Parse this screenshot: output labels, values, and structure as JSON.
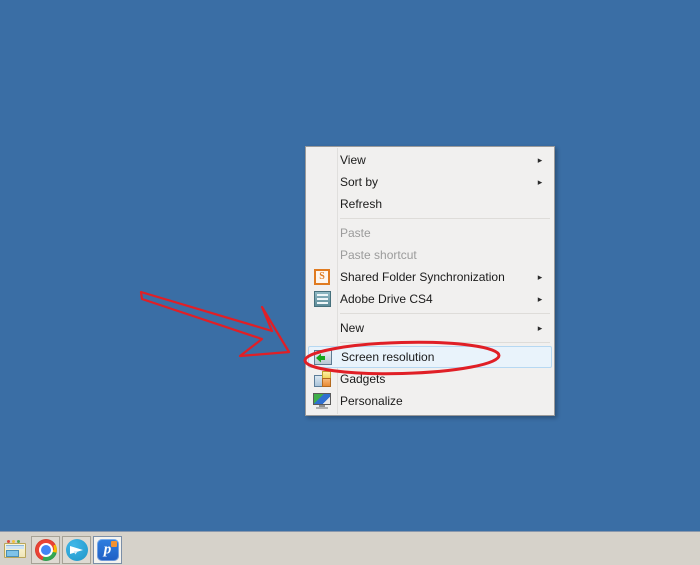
{
  "desktop": {
    "background_color": "#3a6ea5"
  },
  "context_menu": {
    "items": [
      {
        "label": "View",
        "icon": "none",
        "arrow": "▸",
        "disabled": false,
        "highlight": false
      },
      {
        "label": "Sort by",
        "icon": "none",
        "arrow": "▸",
        "disabled": false,
        "highlight": false
      },
      {
        "label": "Refresh",
        "icon": "none",
        "arrow": "",
        "disabled": false,
        "highlight": false
      },
      {
        "separator": true
      },
      {
        "label": "Paste",
        "icon": "none",
        "arrow": "",
        "disabled": true,
        "highlight": false
      },
      {
        "label": "Paste shortcut",
        "icon": "none",
        "arrow": "",
        "disabled": true,
        "highlight": false
      },
      {
        "label": "Shared Folder Synchronization",
        "icon": "shared-folder-sync-icon",
        "arrow": "▸",
        "disabled": false,
        "highlight": false
      },
      {
        "label": "Adobe Drive CS4",
        "icon": "adobe-drive-icon",
        "arrow": "▸",
        "disabled": false,
        "highlight": false
      },
      {
        "separator": true
      },
      {
        "label": "New",
        "icon": "none",
        "arrow": "▸",
        "disabled": false,
        "highlight": false
      },
      {
        "separator": true
      },
      {
        "label": "Screen resolution",
        "icon": "screen-resolution-icon",
        "arrow": "",
        "disabled": false,
        "highlight": true
      },
      {
        "label": "Gadgets",
        "icon": "gadgets-icon",
        "arrow": "",
        "disabled": false,
        "highlight": false
      },
      {
        "label": "Personalize",
        "icon": "personalize-icon",
        "arrow": "",
        "disabled": false,
        "highlight": false
      }
    ]
  },
  "annotations": {
    "arrow": {
      "name": "red-arrow-annotation",
      "color": "#e01f26"
    },
    "ellipse": {
      "name": "red-ellipse-annotation",
      "color": "#e01f26",
      "target_label": "Screen resolution"
    }
  },
  "taskbar": {
    "background_color": "#d6d2ca",
    "buttons": [
      {
        "name": "quick-launch-explorer",
        "icon": "windows-explorer-icon",
        "state": "plain",
        "label": ""
      },
      {
        "name": "taskbar-chrome",
        "icon": "chrome-icon",
        "state": "raised",
        "label": ""
      },
      {
        "name": "taskbar-telegram",
        "icon": "telegram-icon",
        "state": "raised",
        "label": ""
      },
      {
        "name": "taskbar-app4",
        "icon": "blue-app-icon",
        "state": "active",
        "label": "р"
      }
    ]
  }
}
